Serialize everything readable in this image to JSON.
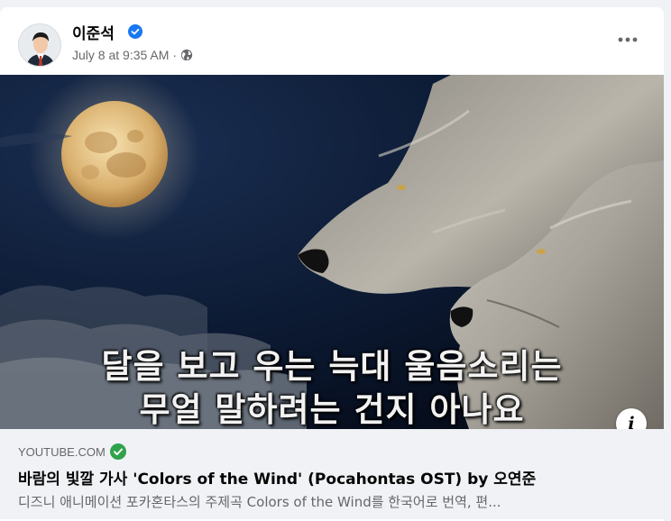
{
  "post": {
    "author": "이준석",
    "timestamp": "July 8 at 9:35 AM",
    "meta_separator": "·",
    "privacy_icon": "globe-icon",
    "verified_icon": "verified-badge-icon",
    "more_icon": "more-options-icon"
  },
  "link": {
    "image_caption_line1": "달을 보고 우는 늑대 울음소리는",
    "image_caption_line2": "무얼 말하려는 건지 아나요",
    "info_label": "i",
    "domain": "YOUTUBE.COM",
    "title": "바람의 빛깔 가사 'Colors of the Wind' (Pocahontas OST) by 오연준",
    "description": "디즈니 애니메이션 포카혼타스의 주제곡 Colors of the Wind를 한국어로 번역, 편..."
  },
  "colors": {
    "accent_blue": "#1877f2",
    "domain_check_green": "#31a24c",
    "secondary_text": "#65676b",
    "preview_background": "#f0f2f5"
  }
}
